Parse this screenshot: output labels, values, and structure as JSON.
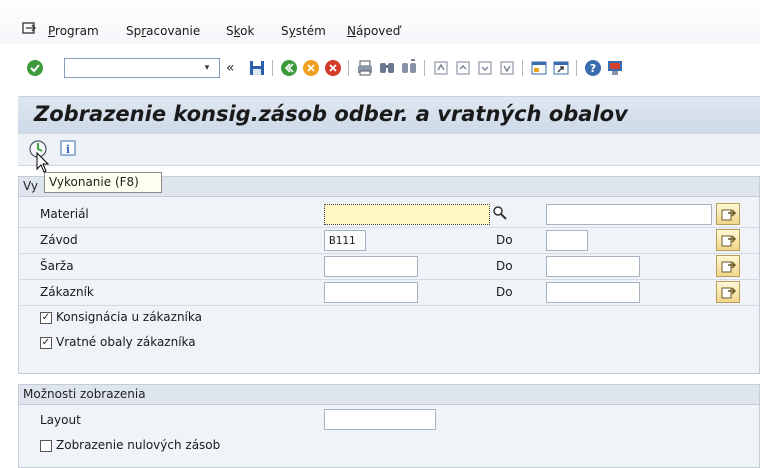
{
  "menu": {
    "items": [
      {
        "pre": "",
        "ul": "P",
        "post": "rogram"
      },
      {
        "pre": "Sp",
        "ul": "r",
        "post": "acovanie"
      },
      {
        "pre": "S",
        "ul": "k",
        "post": "ok"
      },
      {
        "pre": "S",
        "ul": "y",
        "post": "stém"
      },
      {
        "pre": "",
        "ul": "N",
        "post": "ápoveď"
      }
    ]
  },
  "toolbar": {
    "command_value": "",
    "dropdown_glyph": "▾",
    "back_glyph": "«"
  },
  "title": "Zobrazenie konsig.zásob odber. a vratných obalov",
  "tooltip": "Vykonanie   (F8)",
  "selection": {
    "header": "Vy",
    "rows": [
      {
        "label": "Materiál",
        "from": "",
        "to_label": "",
        "to": ""
      },
      {
        "label": "Závod",
        "from": "B111",
        "to_label": "Do",
        "to": ""
      },
      {
        "label": "Šarža",
        "from": "",
        "to_label": "Do",
        "to": ""
      },
      {
        "label": "Zákazník",
        "from": "",
        "to_label": "Do",
        "to": ""
      }
    ],
    "checks": [
      {
        "label": "Konsignácia u zákazníka",
        "checked": true
      },
      {
        "label": "Vratné obaly zákazníka",
        "checked": true
      }
    ]
  },
  "display": {
    "header": "Možnosti zobrazenia",
    "layout_label": "Layout",
    "layout_value": "",
    "zero_label": "Zobrazenie nulových zásob",
    "zero_checked": false
  },
  "check_glyph": "✓"
}
